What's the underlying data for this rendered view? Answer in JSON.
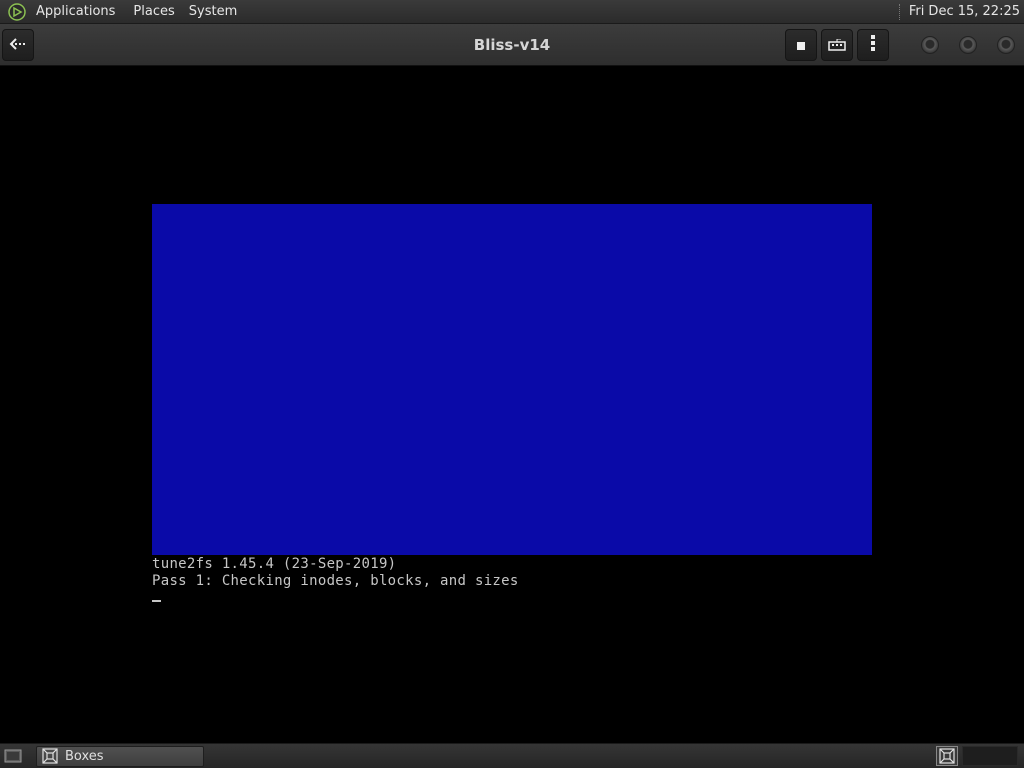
{
  "top_panel": {
    "menus": [
      "Applications",
      "Places",
      "System"
    ],
    "clock": "Fri Dec 15, 22:25"
  },
  "headerbar": {
    "title": "Bliss-v14",
    "buttons": {
      "back": "back-arrow-icon",
      "stop": "stop-icon",
      "keyboard": "keyboard-icon",
      "menu": "vertical-dots-icon"
    }
  },
  "vm_console": {
    "lines": [
      "tune2fs 1.45.4 (23-Sep-2019)",
      "Pass 1: Checking inodes, blocks, and sizes"
    ],
    "screen_color": "#0a0aa8"
  },
  "bottom_panel": {
    "task_label": "Boxes"
  },
  "colors": {
    "panel_bg": "#2b2b2b",
    "headerbar_bg": "#333333",
    "console_text": "#c6c6c6",
    "logo_green": "#8cc152"
  }
}
